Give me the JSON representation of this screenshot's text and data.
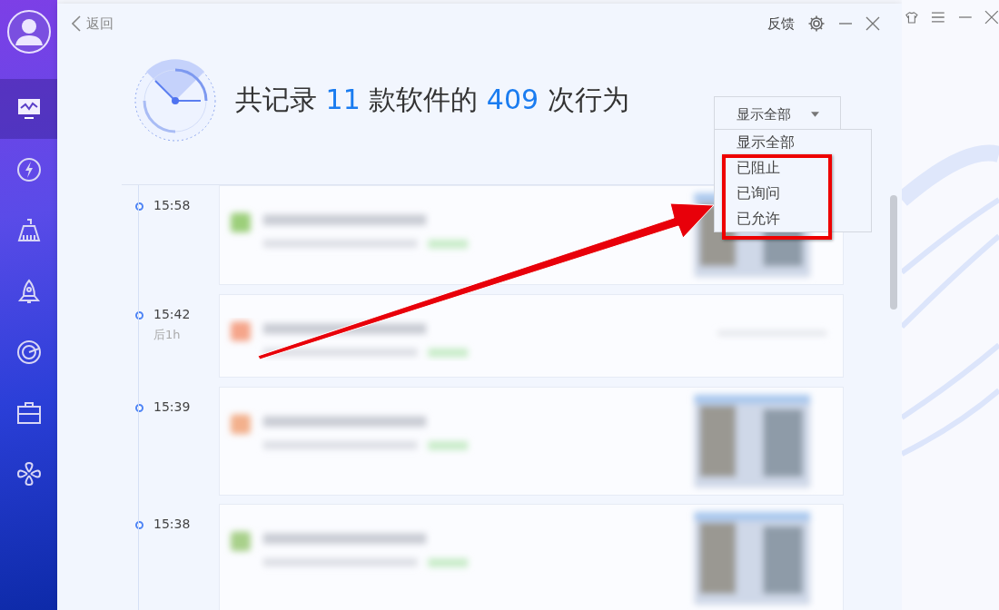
{
  "sidebar": {
    "items": [
      {
        "selected": true
      },
      {
        "selected": false
      },
      {
        "selected": false
      },
      {
        "selected": false
      },
      {
        "selected": false
      },
      {
        "selected": false
      },
      {
        "selected": false
      }
    ]
  },
  "header": {
    "back": "返回",
    "feedback": "反馈"
  },
  "summary": {
    "before": "共记录",
    "software_count": "11",
    "middle": "款软件的",
    "behavior_count": "409",
    "after": "次行为"
  },
  "filter": {
    "value": "显示全部",
    "open": true,
    "options": [
      "显示全部",
      "已阻止",
      "已询问",
      "已允许"
    ]
  },
  "timeline": [
    {
      "time": "15:58"
    },
    {
      "time": "15:42",
      "note": "后1h"
    },
    {
      "time": "15:39"
    },
    {
      "time": "15:38"
    }
  ],
  "annotation": {
    "highlight_box": true,
    "arrow": true
  }
}
